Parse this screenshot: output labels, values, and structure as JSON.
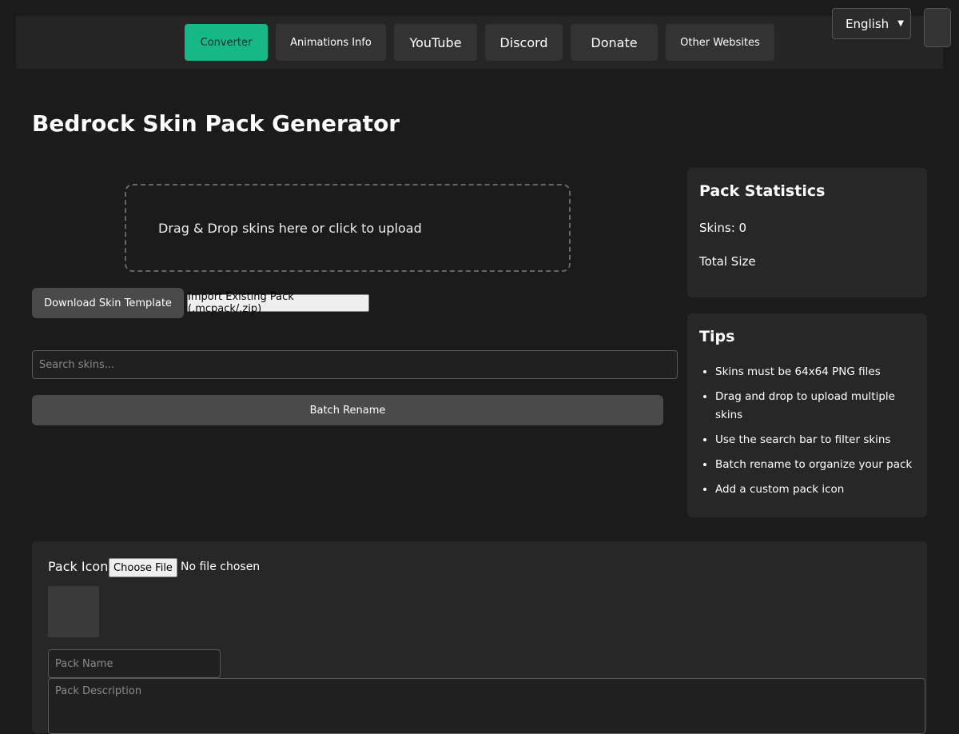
{
  "nav": {
    "items": [
      {
        "label": "Converter",
        "active": true
      },
      {
        "label": "Animations Info"
      },
      {
        "label": "YouTube"
      },
      {
        "label": "Discord"
      },
      {
        "label": "Donate"
      },
      {
        "label": "Other Websites"
      }
    ],
    "active_color": "#16b886"
  },
  "language": {
    "selected": "English"
  },
  "page": {
    "title": "Bedrock Skin Pack Generator"
  },
  "upload": {
    "dropzone_text": "Drag & Drop skins here or click to upload",
    "download_template_label": "Download Skin Template",
    "import_label": "Import Existing Pack (.mcpack/.zip)"
  },
  "search": {
    "placeholder": "Search skins..."
  },
  "batch": {
    "label": "Batch Rename"
  },
  "stats": {
    "title": "Pack Statistics",
    "skins_line": "Skins: 0",
    "total_size_line": "Total Size"
  },
  "tips": {
    "title": "Tips",
    "items": [
      "Skins must be 64x64 PNG files",
      "Drag and drop to upload multiple skins",
      "Use the search bar to filter skins",
      "Batch rename to organize your pack",
      "Add a custom pack icon"
    ]
  },
  "settings": {
    "pack_icon_label": "Pack Icon",
    "choose_file_label": "Choose File",
    "no_file_text": "No file chosen",
    "pack_name_placeholder": "Pack Name",
    "pack_description_placeholder": "Pack Description"
  }
}
